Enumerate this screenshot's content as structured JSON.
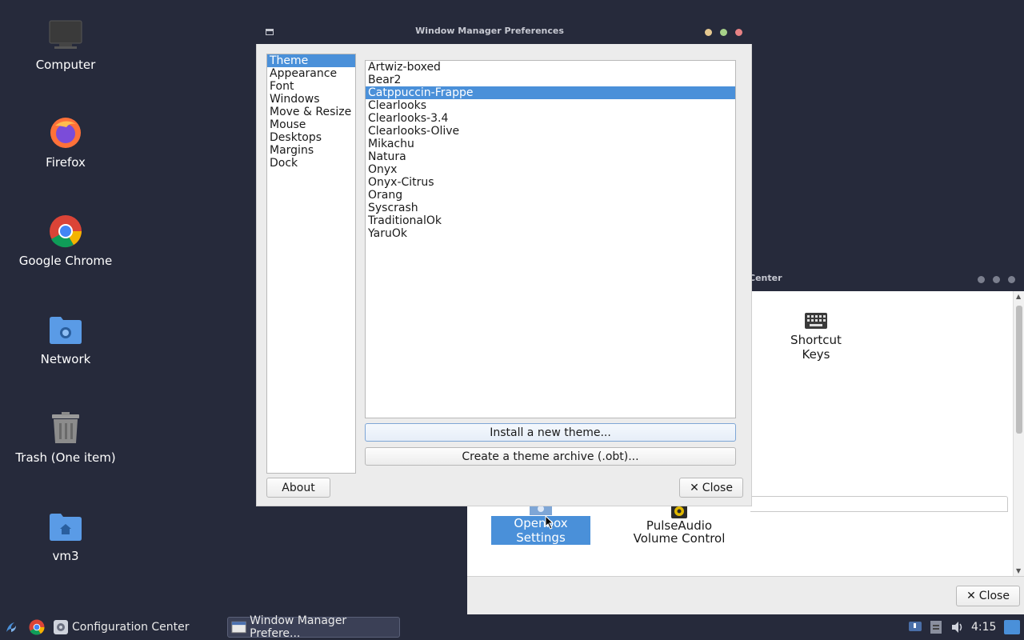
{
  "desktop": {
    "icons": [
      {
        "label": "Computer",
        "icon": "computer-icon"
      },
      {
        "label": "Firefox",
        "icon": "firefox-icon"
      },
      {
        "label": "Google Chrome",
        "icon": "chrome-icon"
      },
      {
        "label": "Network",
        "icon": "network-folder-icon"
      },
      {
        "label": "Trash (One item)",
        "icon": "trash-icon"
      },
      {
        "label": "vm3",
        "icon": "home-folder-icon"
      }
    ]
  },
  "config_center": {
    "title_partial": "Center",
    "items": {
      "shortcut_keys": "Shortcut Keys",
      "openbox_settings": "Openbox Settings",
      "pulseaudio": "PulseAudio Volume Control"
    },
    "close_label": "Close"
  },
  "dialog": {
    "title": "Window Manager Preferences",
    "nav": [
      "Theme",
      "Appearance",
      "Font",
      "Windows",
      "Move & Resize",
      "Mouse",
      "Desktops",
      "Margins",
      "Dock"
    ],
    "nav_selected": "Theme",
    "themes": [
      "Artwiz-boxed",
      "Bear2",
      "Catppuccin-Frappe",
      "Clearlooks",
      "Clearlooks-3.4",
      "Clearlooks-Olive",
      "Mikachu",
      "Natura",
      "Onyx",
      "Onyx-Citrus",
      "Orang",
      "Syscrash",
      "TraditionalOk",
      "YaruOk"
    ],
    "theme_selected": "Catppuccin-Frappe",
    "install_btn": "Install a new theme...",
    "archive_btn": "Create a theme archive (.obt)...",
    "about_btn": "About",
    "close_btn": "Close"
  },
  "taskbar": {
    "config_center": "Configuration Center",
    "wm_prefs": "Window Manager Prefere...",
    "clock": "4:15"
  },
  "colors": {
    "desktop_bg": "#262a3b",
    "selection": "#4a90d9",
    "dot_yellow": "#e5c890",
    "dot_green": "#a6d189",
    "dot_red": "#e78284"
  }
}
